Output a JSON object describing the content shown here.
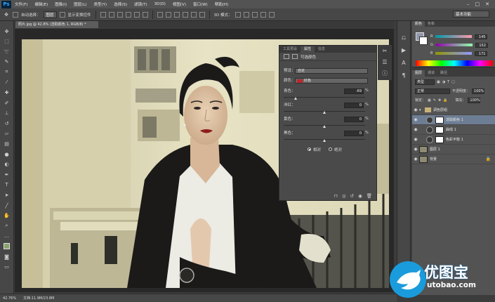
{
  "app": {
    "logo": "Ps"
  },
  "menu": [
    "文件(F)",
    "编辑(E)",
    "图像(I)",
    "图层(L)",
    "类型(Y)",
    "选择(S)",
    "滤镜(T)",
    "3D(D)",
    "视图(V)",
    "窗口(W)",
    "帮助(H)"
  ],
  "options": {
    "auto_select_label": "自动选择：",
    "auto_select_value": "图层",
    "show_transform_label": "显示变换控件",
    "mode_3d_label": "3D 模式：",
    "workspace": "基本功能"
  },
  "document": {
    "tab": "照片.jpg @ 42.8% (选取颜色 1, RGB/8) *"
  },
  "status": {
    "zoom": "42.76%",
    "doc_size": "文档:11.9M/23.8M"
  },
  "properties": {
    "tabs": [
      "工具预设",
      "属性",
      "信息"
    ],
    "title": "可选颜色",
    "preset_label": "预设：",
    "preset_value": "自定",
    "colors_label": "颜色：",
    "colors_value": "红色",
    "swatch_color": "#c0262a",
    "sliders": [
      {
        "label": "青色：",
        "value": "-69",
        "thumb": 0.155
      },
      {
        "label": "洋红：",
        "value": "0",
        "thumb": 0.5
      },
      {
        "label": "黄色：",
        "value": "0",
        "thumb": 0.5
      },
      {
        "label": "黑色：",
        "value": "0",
        "thumb": 0.5
      }
    ],
    "pct": "%",
    "method_relative": "相对",
    "method_absolute": "绝对"
  },
  "color_panel": {
    "tabs": [
      "颜色",
      "色板"
    ],
    "rows": [
      {
        "label": "R",
        "value": "145"
      },
      {
        "label": "G",
        "value": "152"
      },
      {
        "label": "B",
        "value": "171"
      }
    ]
  },
  "layers_panel": {
    "tabs": [
      "图层",
      "通道",
      "路径"
    ],
    "filter": "类型",
    "blend_mode": "正常",
    "opacity_label": "不透明度：",
    "opacity_value": "100%",
    "lock_label": "锁定：",
    "fill_label": "填充：",
    "fill_value": "100%",
    "layers": [
      {
        "name": "调色层组"
      },
      {
        "name": "选取颜色 1"
      },
      {
        "name": "曲线 1"
      },
      {
        "name": "色彩平衡 1"
      },
      {
        "name": "图层 1"
      },
      {
        "name": "背景"
      }
    ]
  },
  "watermark": {
    "brand": "优图宝",
    "url": "utobao.com"
  }
}
